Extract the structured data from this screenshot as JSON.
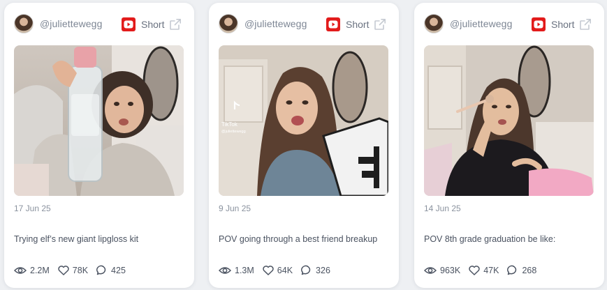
{
  "colors": {
    "youtube_red": "#e21b1b",
    "text_muted": "#7d8694",
    "text_body": "#4a5260"
  },
  "cards": [
    {
      "handle": "@juliettewegg",
      "platform": "Short",
      "platform_icon": "youtube-icon",
      "date": "17 Jun 25",
      "caption": "Trying elf’s new ‍‍giant lipgloss kit",
      "views": "2.2M",
      "likes": "78K",
      "comments": "425"
    },
    {
      "handle": "@juliettewegg",
      "platform": "Short",
      "platform_icon": "youtube-icon",
      "thumb_overlay": "TikTok",
      "thumb_overlay_handle": "@juliettewegg",
      "date": "9 Jun 25",
      "caption": "POV going through a best friend breakup",
      "views": "1.3M",
      "likes": "64K",
      "comments": "326"
    },
    {
      "handle": "@juliettewegg",
      "platform": "Short",
      "platform_icon": "youtube-icon",
      "date": "14 Jun 25",
      "caption": "POV 8th grade graduation be like:",
      "views": "963K",
      "likes": "47K",
      "comments": "268"
    }
  ]
}
